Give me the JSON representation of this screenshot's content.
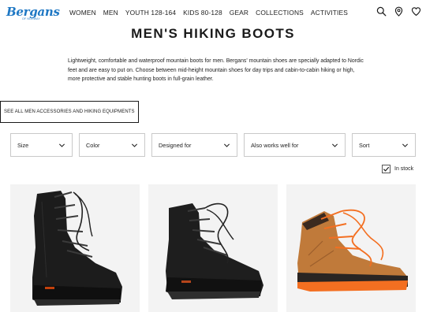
{
  "brand": {
    "logo_text": "Bergans",
    "logo_subtext": "OF NORWAY"
  },
  "nav": {
    "items": [
      "WOMEN",
      "MEN",
      "YOUTH 128-164",
      "KIDS 80-128",
      "GEAR",
      "COLLECTIONS",
      "ACTIVITIES"
    ]
  },
  "header_icons": [
    "search-icon",
    "location-pin-icon",
    "heart-icon"
  ],
  "page": {
    "title": "MEN'S HIKING BOOTS",
    "intro": "Lightweight, comfortable and waterproof mountain boots for men. Bergans' mountain shoes are specially adapted to Nordic feet and are easy to put on. Choose between mid-height mountain shoes for day trips and cabin-to-cabin hiking or high, more protective and stable hunting boots in full-grain leather."
  },
  "accessories_button": {
    "label": "SEE ALL MEN ACCESSORIES AND HIKING EQUIPMENTS"
  },
  "filters": [
    {
      "label": "Size"
    },
    {
      "label": "Color"
    },
    {
      "label": "Designed for"
    },
    {
      "label": "Also works well for"
    },
    {
      "label": "Sort"
    }
  ],
  "in_stock": {
    "label": "In stock",
    "checked": true
  },
  "products": [
    {
      "name": "black-high-hunting-boot",
      "color": "#1c1c1c",
      "accent": "#c2410c"
    },
    {
      "name": "black-mid-hiking-boot",
      "color": "#1e1e1e",
      "accent": "#b5451b"
    },
    {
      "name": "tan-hiking-boot-orange-laces",
      "color": "#c07a3a",
      "accent": "#f36f21"
    }
  ]
}
